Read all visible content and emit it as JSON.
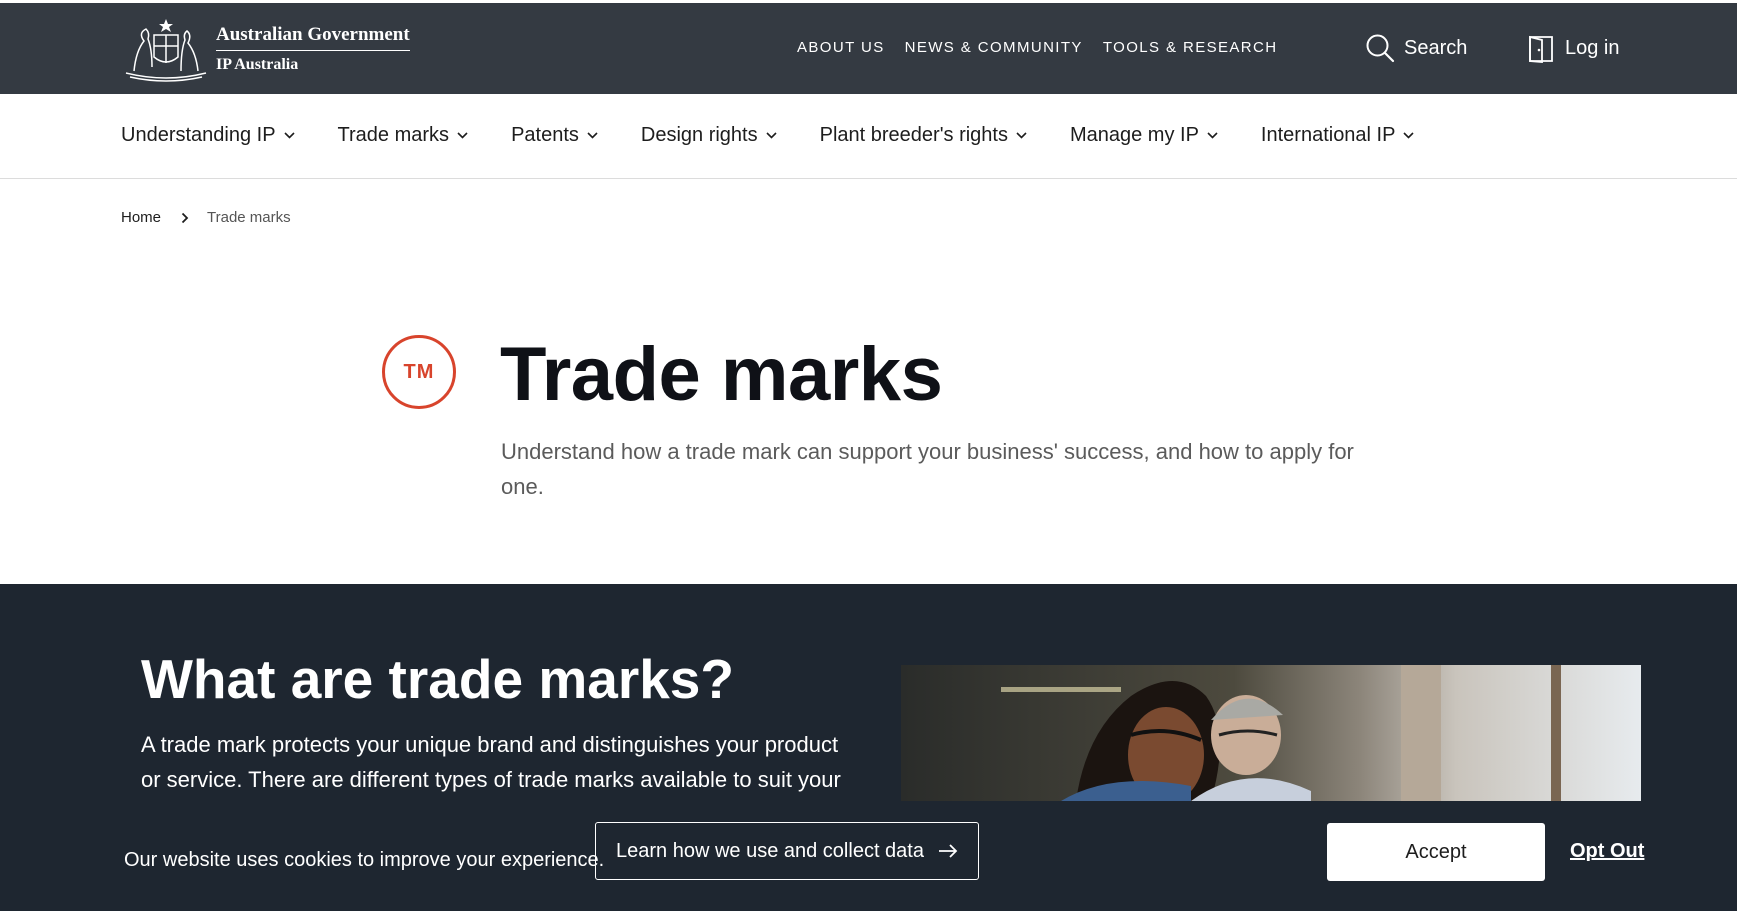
{
  "header": {
    "logo_line1": "Australian Government",
    "logo_line2": "IP Australia",
    "utility_links": [
      "ABOUT US",
      "NEWS & COMMUNITY",
      "TOOLS & RESEARCH"
    ],
    "search_label": "Search",
    "login_label": "Log in"
  },
  "nav": {
    "items": [
      "Understanding IP",
      "Trade marks",
      "Patents",
      "Design rights",
      "Plant breeder's rights",
      "Manage my IP",
      "International IP"
    ]
  },
  "breadcrumb": {
    "home": "Home",
    "current": "Trade marks"
  },
  "hero": {
    "icon_text": "TM",
    "title": "Trade marks",
    "subtitle": "Understand how a trade mark can support your business' success, and how to apply for one."
  },
  "section": {
    "heading": "What are trade marks?",
    "text": "A trade mark protects your unique brand and distinguishes your product or service. There are different types of trade marks available to suit your"
  },
  "cookie": {
    "message": "Our website uses cookies to improve your experience.",
    "learn_label": "Learn how we use and collect data",
    "accept_label": "Accept",
    "optout_label": "Opt Out"
  },
  "colors": {
    "topbar": "#343a42",
    "dark_section": "#1e2630",
    "accent": "#d8442c"
  }
}
